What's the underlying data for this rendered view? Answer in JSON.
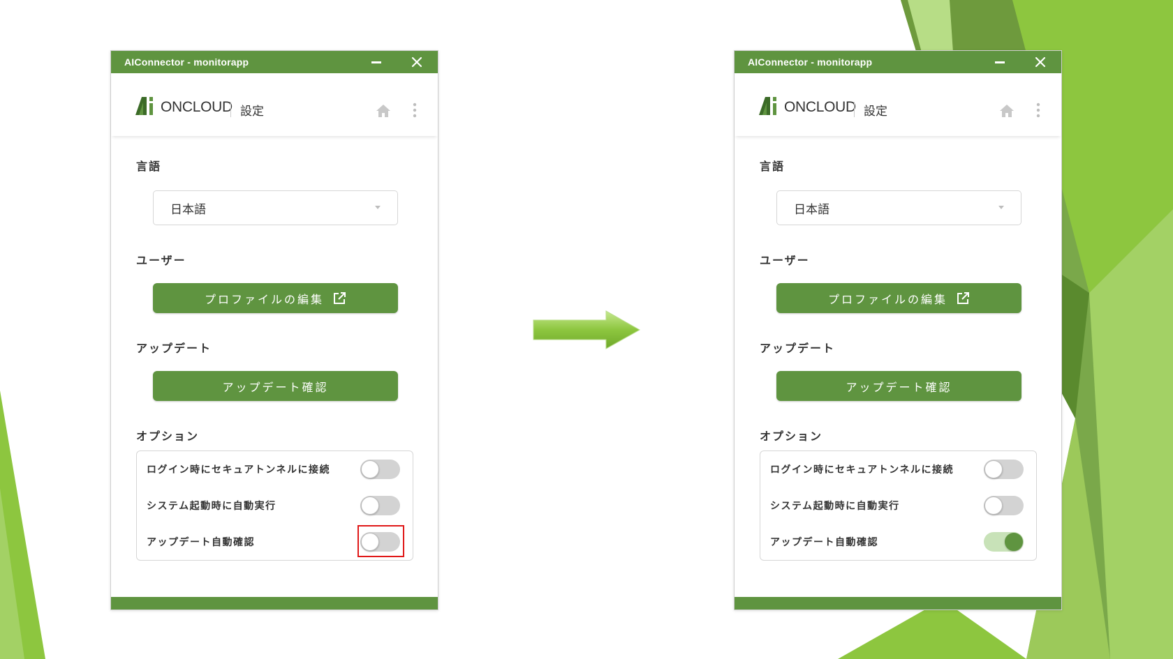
{
  "colors": {
    "brand_green": "#5f9440",
    "toggle_off": "#d3d3d3",
    "toggle_on_track": "#c8e2b8",
    "highlight_red": "#e01818",
    "background_greens": [
      "#8dc63f",
      "#6e9a3d",
      "#a3d165",
      "#5a8a2e"
    ]
  },
  "windows": [
    {
      "id": "before",
      "titlebar": {
        "title": "AIConnector - monitorapp",
        "minimize_icon": "minimize-icon",
        "close_icon": "close-icon"
      },
      "header": {
        "logo_letters": "Ai",
        "logo_text": "ONCLOUD",
        "page_title": "設定",
        "home_icon": "home-icon",
        "menu_icon": "kebab-menu-icon"
      },
      "language": {
        "label": "言語",
        "selected": "日本語"
      },
      "user": {
        "label": "ユーザー",
        "edit_profile": "プロファイルの編集"
      },
      "update": {
        "label": "アップデート",
        "check_button": "アップデート確認"
      },
      "options": {
        "label": "オプション",
        "items": [
          {
            "label": "ログイン時にセキュアトンネルに接続",
            "enabled": false
          },
          {
            "label": "システム起動時に自動実行",
            "enabled": false
          },
          {
            "label": "アップデート自動確認",
            "enabled": false,
            "highlighted": true
          }
        ]
      }
    },
    {
      "id": "after",
      "titlebar": {
        "title": "AIConnector - monitorapp",
        "minimize_icon": "minimize-icon",
        "close_icon": "close-icon"
      },
      "header": {
        "logo_letters": "Ai",
        "logo_text": "ONCLOUD",
        "page_title": "設定",
        "home_icon": "home-icon",
        "menu_icon": "kebab-menu-icon"
      },
      "language": {
        "label": "言語",
        "selected": "日本語"
      },
      "user": {
        "label": "ユーザー",
        "edit_profile": "プロファイルの編集"
      },
      "update": {
        "label": "アップデート",
        "check_button": "アップデート確認"
      },
      "options": {
        "label": "オプション",
        "items": [
          {
            "label": "ログイン時にセキュアトンネルに接続",
            "enabled": false
          },
          {
            "label": "システム起動時に自動実行",
            "enabled": false
          },
          {
            "label": "アップデート自動確認",
            "enabled": true
          }
        ]
      }
    }
  ],
  "transition_icon": "right-arrow-icon"
}
